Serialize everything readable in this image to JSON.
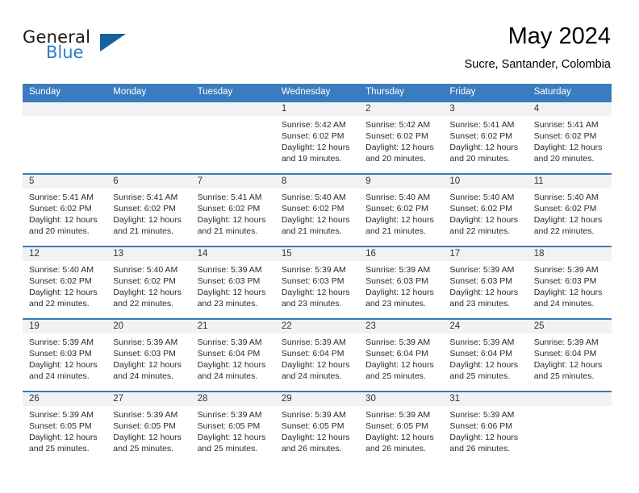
{
  "brand": {
    "name_top": "General",
    "name_bottom": "Blue",
    "accent_color": "#2a7fc9",
    "triangle_color": "#17619e"
  },
  "header": {
    "month_title": "May 2024",
    "location": "Sucre, Santander, Colombia"
  },
  "theme": {
    "header_blue": "#3a7cbe",
    "day_band_gray": "#f2f2f2"
  },
  "weekdays": [
    "Sunday",
    "Monday",
    "Tuesday",
    "Wednesday",
    "Thursday",
    "Friday",
    "Saturday"
  ],
  "weeks": [
    [
      {
        "day": "",
        "sunrise": "",
        "sunset": "",
        "daylight1": "",
        "daylight2": ""
      },
      {
        "day": "",
        "sunrise": "",
        "sunset": "",
        "daylight1": "",
        "daylight2": ""
      },
      {
        "day": "",
        "sunrise": "",
        "sunset": "",
        "daylight1": "",
        "daylight2": ""
      },
      {
        "day": "1",
        "sunrise": "Sunrise: 5:42 AM",
        "sunset": "Sunset: 6:02 PM",
        "daylight1": "Daylight: 12 hours",
        "daylight2": "and 19 minutes."
      },
      {
        "day": "2",
        "sunrise": "Sunrise: 5:42 AM",
        "sunset": "Sunset: 6:02 PM",
        "daylight1": "Daylight: 12 hours",
        "daylight2": "and 20 minutes."
      },
      {
        "day": "3",
        "sunrise": "Sunrise: 5:41 AM",
        "sunset": "Sunset: 6:02 PM",
        "daylight1": "Daylight: 12 hours",
        "daylight2": "and 20 minutes."
      },
      {
        "day": "4",
        "sunrise": "Sunrise: 5:41 AM",
        "sunset": "Sunset: 6:02 PM",
        "daylight1": "Daylight: 12 hours",
        "daylight2": "and 20 minutes."
      }
    ],
    [
      {
        "day": "5",
        "sunrise": "Sunrise: 5:41 AM",
        "sunset": "Sunset: 6:02 PM",
        "daylight1": "Daylight: 12 hours",
        "daylight2": "and 20 minutes."
      },
      {
        "day": "6",
        "sunrise": "Sunrise: 5:41 AM",
        "sunset": "Sunset: 6:02 PM",
        "daylight1": "Daylight: 12 hours",
        "daylight2": "and 21 minutes."
      },
      {
        "day": "7",
        "sunrise": "Sunrise: 5:41 AM",
        "sunset": "Sunset: 6:02 PM",
        "daylight1": "Daylight: 12 hours",
        "daylight2": "and 21 minutes."
      },
      {
        "day": "8",
        "sunrise": "Sunrise: 5:40 AM",
        "sunset": "Sunset: 6:02 PM",
        "daylight1": "Daylight: 12 hours",
        "daylight2": "and 21 minutes."
      },
      {
        "day": "9",
        "sunrise": "Sunrise: 5:40 AM",
        "sunset": "Sunset: 6:02 PM",
        "daylight1": "Daylight: 12 hours",
        "daylight2": "and 21 minutes."
      },
      {
        "day": "10",
        "sunrise": "Sunrise: 5:40 AM",
        "sunset": "Sunset: 6:02 PM",
        "daylight1": "Daylight: 12 hours",
        "daylight2": "and 22 minutes."
      },
      {
        "day": "11",
        "sunrise": "Sunrise: 5:40 AM",
        "sunset": "Sunset: 6:02 PM",
        "daylight1": "Daylight: 12 hours",
        "daylight2": "and 22 minutes."
      }
    ],
    [
      {
        "day": "12",
        "sunrise": "Sunrise: 5:40 AM",
        "sunset": "Sunset: 6:02 PM",
        "daylight1": "Daylight: 12 hours",
        "daylight2": "and 22 minutes."
      },
      {
        "day": "13",
        "sunrise": "Sunrise: 5:40 AM",
        "sunset": "Sunset: 6:02 PM",
        "daylight1": "Daylight: 12 hours",
        "daylight2": "and 22 minutes."
      },
      {
        "day": "14",
        "sunrise": "Sunrise: 5:39 AM",
        "sunset": "Sunset: 6:03 PM",
        "daylight1": "Daylight: 12 hours",
        "daylight2": "and 23 minutes."
      },
      {
        "day": "15",
        "sunrise": "Sunrise: 5:39 AM",
        "sunset": "Sunset: 6:03 PM",
        "daylight1": "Daylight: 12 hours",
        "daylight2": "and 23 minutes."
      },
      {
        "day": "16",
        "sunrise": "Sunrise: 5:39 AM",
        "sunset": "Sunset: 6:03 PM",
        "daylight1": "Daylight: 12 hours",
        "daylight2": "and 23 minutes."
      },
      {
        "day": "17",
        "sunrise": "Sunrise: 5:39 AM",
        "sunset": "Sunset: 6:03 PM",
        "daylight1": "Daylight: 12 hours",
        "daylight2": "and 23 minutes."
      },
      {
        "day": "18",
        "sunrise": "Sunrise: 5:39 AM",
        "sunset": "Sunset: 6:03 PM",
        "daylight1": "Daylight: 12 hours",
        "daylight2": "and 24 minutes."
      }
    ],
    [
      {
        "day": "19",
        "sunrise": "Sunrise: 5:39 AM",
        "sunset": "Sunset: 6:03 PM",
        "daylight1": "Daylight: 12 hours",
        "daylight2": "and 24 minutes."
      },
      {
        "day": "20",
        "sunrise": "Sunrise: 5:39 AM",
        "sunset": "Sunset: 6:03 PM",
        "daylight1": "Daylight: 12 hours",
        "daylight2": "and 24 minutes."
      },
      {
        "day": "21",
        "sunrise": "Sunrise: 5:39 AM",
        "sunset": "Sunset: 6:04 PM",
        "daylight1": "Daylight: 12 hours",
        "daylight2": "and 24 minutes."
      },
      {
        "day": "22",
        "sunrise": "Sunrise: 5:39 AM",
        "sunset": "Sunset: 6:04 PM",
        "daylight1": "Daylight: 12 hours",
        "daylight2": "and 24 minutes."
      },
      {
        "day": "23",
        "sunrise": "Sunrise: 5:39 AM",
        "sunset": "Sunset: 6:04 PM",
        "daylight1": "Daylight: 12 hours",
        "daylight2": "and 25 minutes."
      },
      {
        "day": "24",
        "sunrise": "Sunrise: 5:39 AM",
        "sunset": "Sunset: 6:04 PM",
        "daylight1": "Daylight: 12 hours",
        "daylight2": "and 25 minutes."
      },
      {
        "day": "25",
        "sunrise": "Sunrise: 5:39 AM",
        "sunset": "Sunset: 6:04 PM",
        "daylight1": "Daylight: 12 hours",
        "daylight2": "and 25 minutes."
      }
    ],
    [
      {
        "day": "26",
        "sunrise": "Sunrise: 5:39 AM",
        "sunset": "Sunset: 6:05 PM",
        "daylight1": "Daylight: 12 hours",
        "daylight2": "and 25 minutes."
      },
      {
        "day": "27",
        "sunrise": "Sunrise: 5:39 AM",
        "sunset": "Sunset: 6:05 PM",
        "daylight1": "Daylight: 12 hours",
        "daylight2": "and 25 minutes."
      },
      {
        "day": "28",
        "sunrise": "Sunrise: 5:39 AM",
        "sunset": "Sunset: 6:05 PM",
        "daylight1": "Daylight: 12 hours",
        "daylight2": "and 25 minutes."
      },
      {
        "day": "29",
        "sunrise": "Sunrise: 5:39 AM",
        "sunset": "Sunset: 6:05 PM",
        "daylight1": "Daylight: 12 hours",
        "daylight2": "and 26 minutes."
      },
      {
        "day": "30",
        "sunrise": "Sunrise: 5:39 AM",
        "sunset": "Sunset: 6:05 PM",
        "daylight1": "Daylight: 12 hours",
        "daylight2": "and 26 minutes."
      },
      {
        "day": "31",
        "sunrise": "Sunrise: 5:39 AM",
        "sunset": "Sunset: 6:06 PM",
        "daylight1": "Daylight: 12 hours",
        "daylight2": "and 26 minutes."
      },
      {
        "day": "",
        "sunrise": "",
        "sunset": "",
        "daylight1": "",
        "daylight2": ""
      }
    ]
  ]
}
